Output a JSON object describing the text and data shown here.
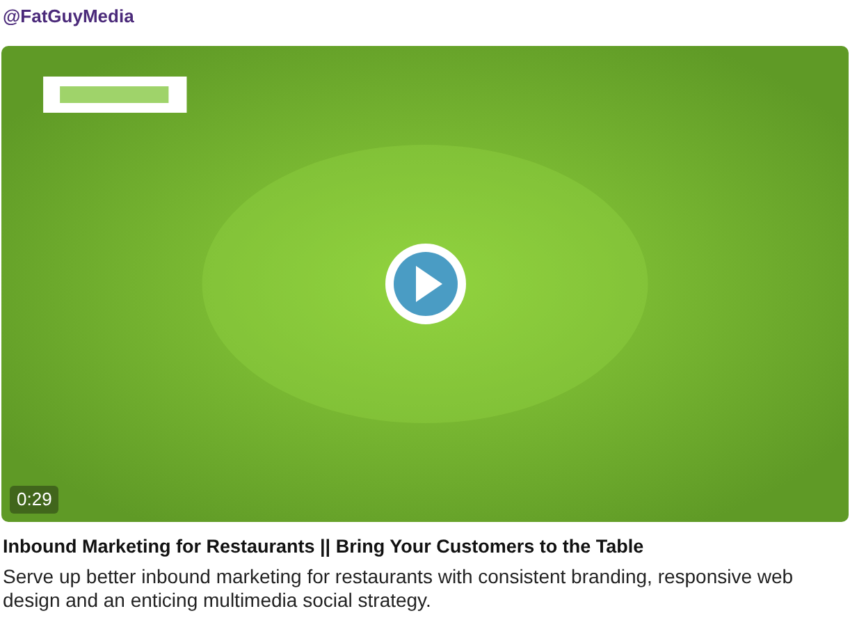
{
  "account": {
    "handle": "@FatGuyMedia"
  },
  "video": {
    "kind": "picture",
    "duration": "0:29"
  },
  "title": "Inbound Marketing for Restaurants || Bring Your Customers to the Table",
  "description": "Serve up better inbound marketing for restaurants with consistent branding, responsive web design and an enticing multimedia social strategy."
}
